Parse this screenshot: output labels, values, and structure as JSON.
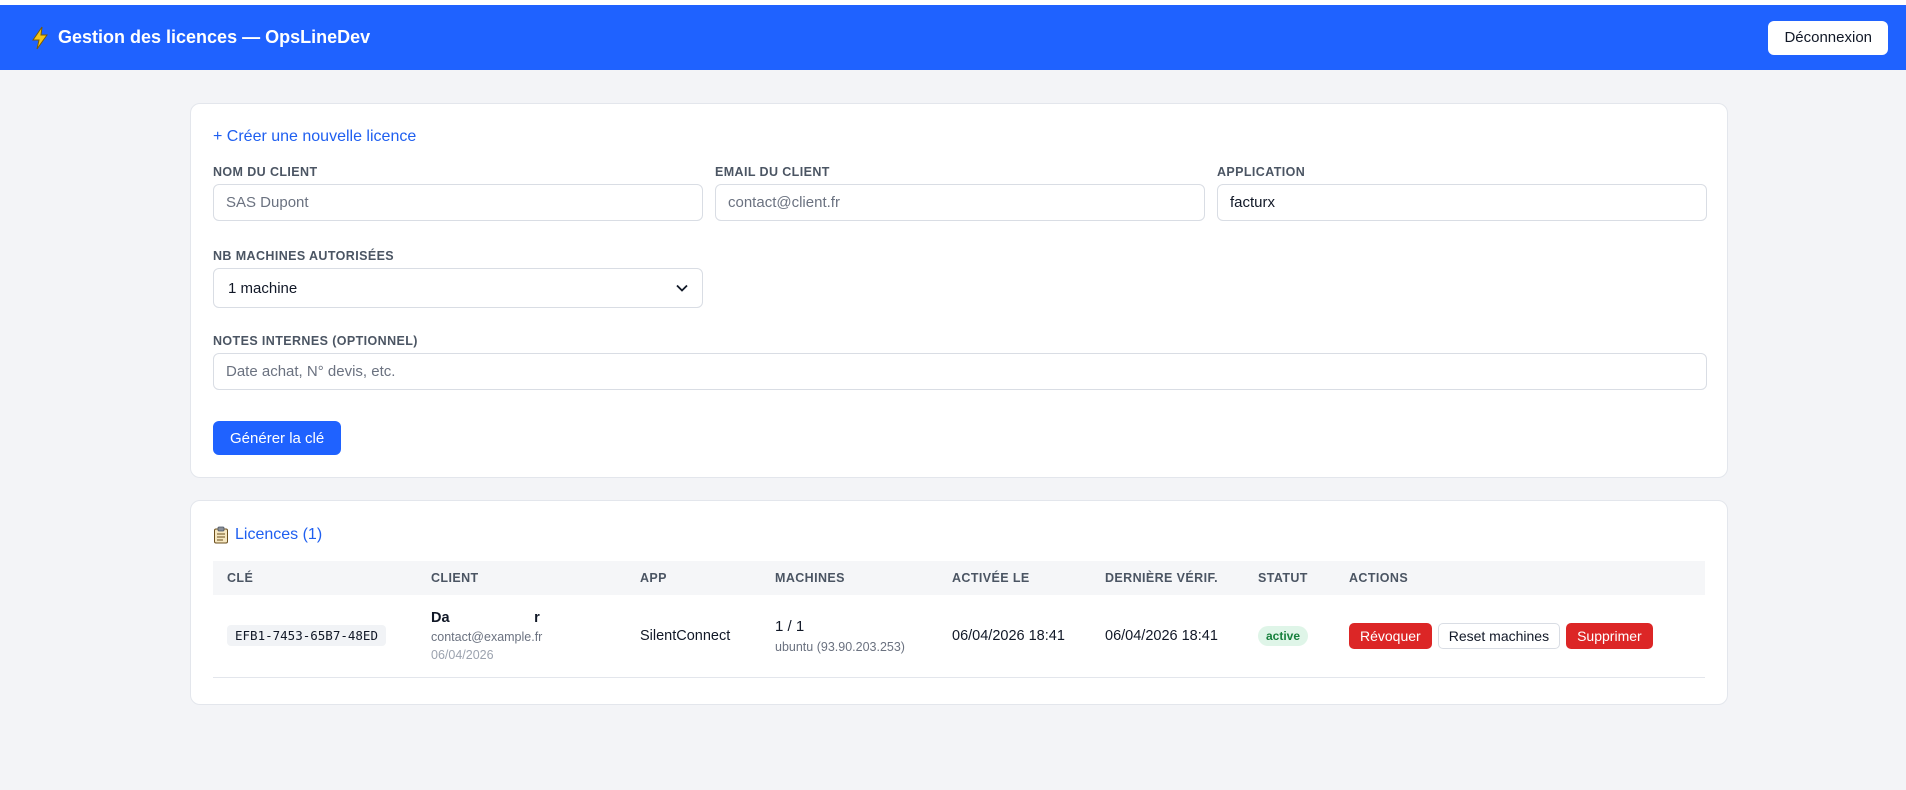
{
  "header": {
    "title": "Gestion des licences — OpsLineDev",
    "logout_label": "Déconnexion"
  },
  "create_form": {
    "title": "+ Créer une nouvelle licence",
    "client_name": {
      "label": "NOM DU CLIENT",
      "placeholder": "SAS Dupont",
      "value": ""
    },
    "client_email": {
      "label": "EMAIL DU CLIENT",
      "placeholder": "contact@client.fr",
      "value": ""
    },
    "application": {
      "label": "APPLICATION",
      "placeholder": "",
      "value": "facturx"
    },
    "machines": {
      "label": "NB MACHINES AUTORISÉES",
      "selected": "1 machine"
    },
    "notes": {
      "label": "NOTES INTERNES (OPTIONNEL)",
      "placeholder": "Date achat, N° devis, etc.",
      "value": ""
    },
    "submit_label": "Générer la clé"
  },
  "licences": {
    "title": "Licences (1)",
    "columns": [
      "CLÉ",
      "CLIENT",
      "APP",
      "MACHINES",
      "ACTIVÉE LE",
      "DERNIÈRE VÉRIF.",
      "STATUT",
      "ACTIONS"
    ],
    "rows": [
      {
        "key": "EFB1-7453-65B7-48ED",
        "client_name": "Da                     r",
        "client_email": "contact@example.fr",
        "client_date": "06/04/2026",
        "app": "SilentConnect",
        "machines": "1 / 1",
        "machine_host": "ubuntu (93.90.203.253)",
        "activated": "06/04/2026 18:41",
        "last_check": "06/04/2026 18:41",
        "status": "active",
        "actions": {
          "revoke": "Révoquer",
          "reset": "Reset machines",
          "delete": "Supprimer"
        }
      }
    ]
  },
  "colors": {
    "primary": "#1f62ff",
    "danger": "#dc2626",
    "success_bg": "#dff5e8",
    "success_text": "#16803c"
  },
  "icons": {
    "header": "bolt-icon",
    "list": "clipboard-icon",
    "select": "chevron-down-icon"
  }
}
